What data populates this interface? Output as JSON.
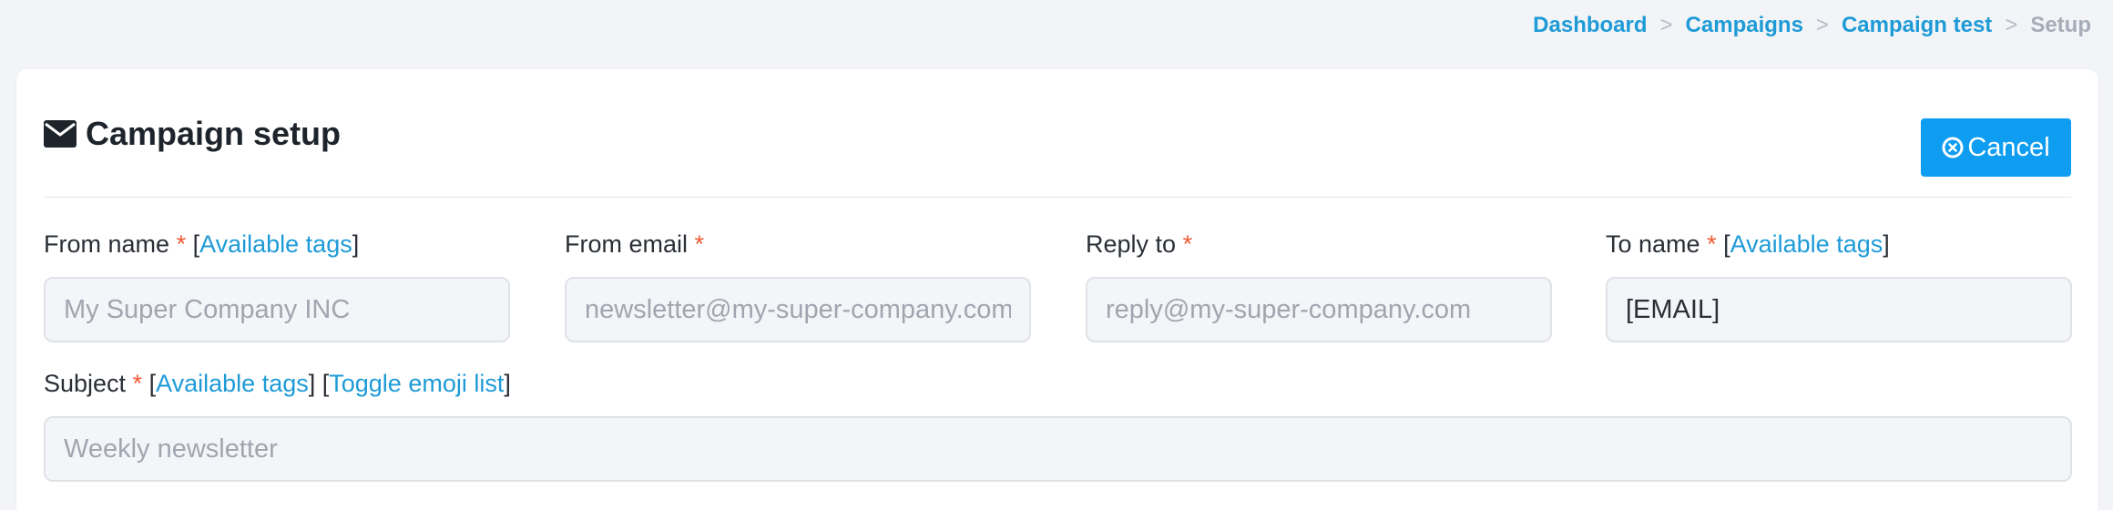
{
  "breadcrumb": {
    "items": [
      "Dashboard",
      "Campaigns",
      "Campaign test"
    ],
    "separator": ">",
    "current": "Setup"
  },
  "header": {
    "title": "Campaign setup",
    "title_icon": "envelope-icon",
    "cancel_label": "Cancel",
    "cancel_icon": "close-circle-icon"
  },
  "form": {
    "required_mark": "*",
    "tags_link": "Available tags",
    "emoji_link": "Toggle emoji list",
    "from_name": {
      "label": "From name",
      "placeholder": "My Super Company INC",
      "value": ""
    },
    "from_email": {
      "label": "From email",
      "placeholder": "newsletter@my-super-company.com",
      "value": ""
    },
    "reply_to": {
      "label": "Reply to",
      "placeholder": "reply@my-super-company.com",
      "value": ""
    },
    "to_name": {
      "label": "To name",
      "placeholder": "",
      "value": "[EMAIL]"
    },
    "subject": {
      "label": "Subject",
      "placeholder": "Weekly newsletter",
      "value": ""
    }
  },
  "colors": {
    "accent": "#0e9df0",
    "link": "#1e9bd7",
    "required": "#ef5a34",
    "background": "#f3f4f7"
  }
}
